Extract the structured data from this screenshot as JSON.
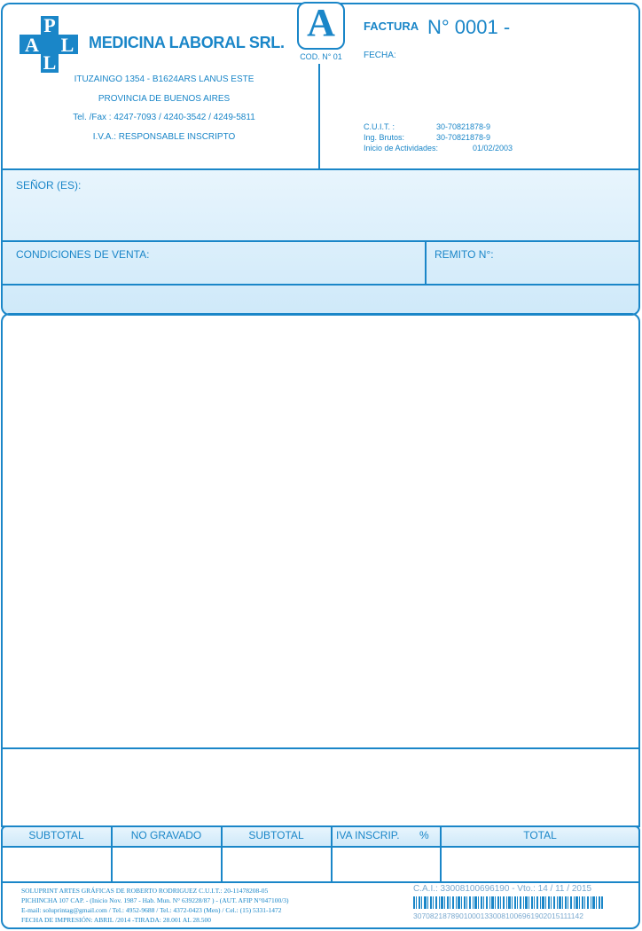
{
  "company": {
    "logo_letters": [
      "P",
      "A",
      "L"
    ],
    "name": "MEDICINA LABORAL SRL.",
    "address": "ITUZAINGO 1354 - B1624ARS LANUS ESTE",
    "province": "PROVINCIA DE BUENOS AIRES",
    "phones": "Tel. /Fax : 4247-7093 / 4240-3542 / 4249-5811",
    "iva": "I.V.A.: RESPONSABLE INSCRIPTO"
  },
  "invoice": {
    "type_letter": "A",
    "cod": "COD. N° 01",
    "title": "FACTURA",
    "number": "N° 0001 -",
    "fecha_label": "FECHA:",
    "cuit_label": "C.U.I.T. :",
    "cuit_value": "30-70821878-9",
    "ib_label": "Ing. Brutos:",
    "ib_value": "30-70821878-9",
    "inicio_label": "Inicio de Actividades:",
    "inicio_value": "01/02/2003"
  },
  "client": {
    "senor_label": "SEÑOR (ES):",
    "condiciones_label": "CONDICIONES DE VENTA:",
    "remito_label": "REMITO N°:"
  },
  "totals": {
    "subtotal1": "SUBTOTAL",
    "no_gravado": "NO GRAVADO",
    "subtotal2": "SUBTOTAL",
    "iva": "IVA INSCRIP.",
    "percent": "%",
    "total": "TOTAL"
  },
  "footer": {
    "line1": "SOLUPRINT ARTES GRÁFICAS DE ROBERTO RODRIGUEZ C.U.I.T.: 20-11478208-05",
    "line2": "PICHINCHA 107 CAP.  - (Inicio Nov. 1987 - Hab. Mun. N° 639228/87 ) - (AUT. AFIP N°047100/3)",
    "line3": "E-mail: soluprintag@gmail.com / Tel.: 4952-9688 / Tel.: 4372-0423 (Men) / Cel.: (15) 5331-1472",
    "line4": "FECHA DE IMPRESIÓN: ABRIL /2014 -TIRADA: 28.001 AL 28.500",
    "cai": "C.A.I.: 33008100696190  -  Vto.: 14 / 11 / 2015",
    "barcode_number": "30708218789010001330081006961902015111142"
  }
}
